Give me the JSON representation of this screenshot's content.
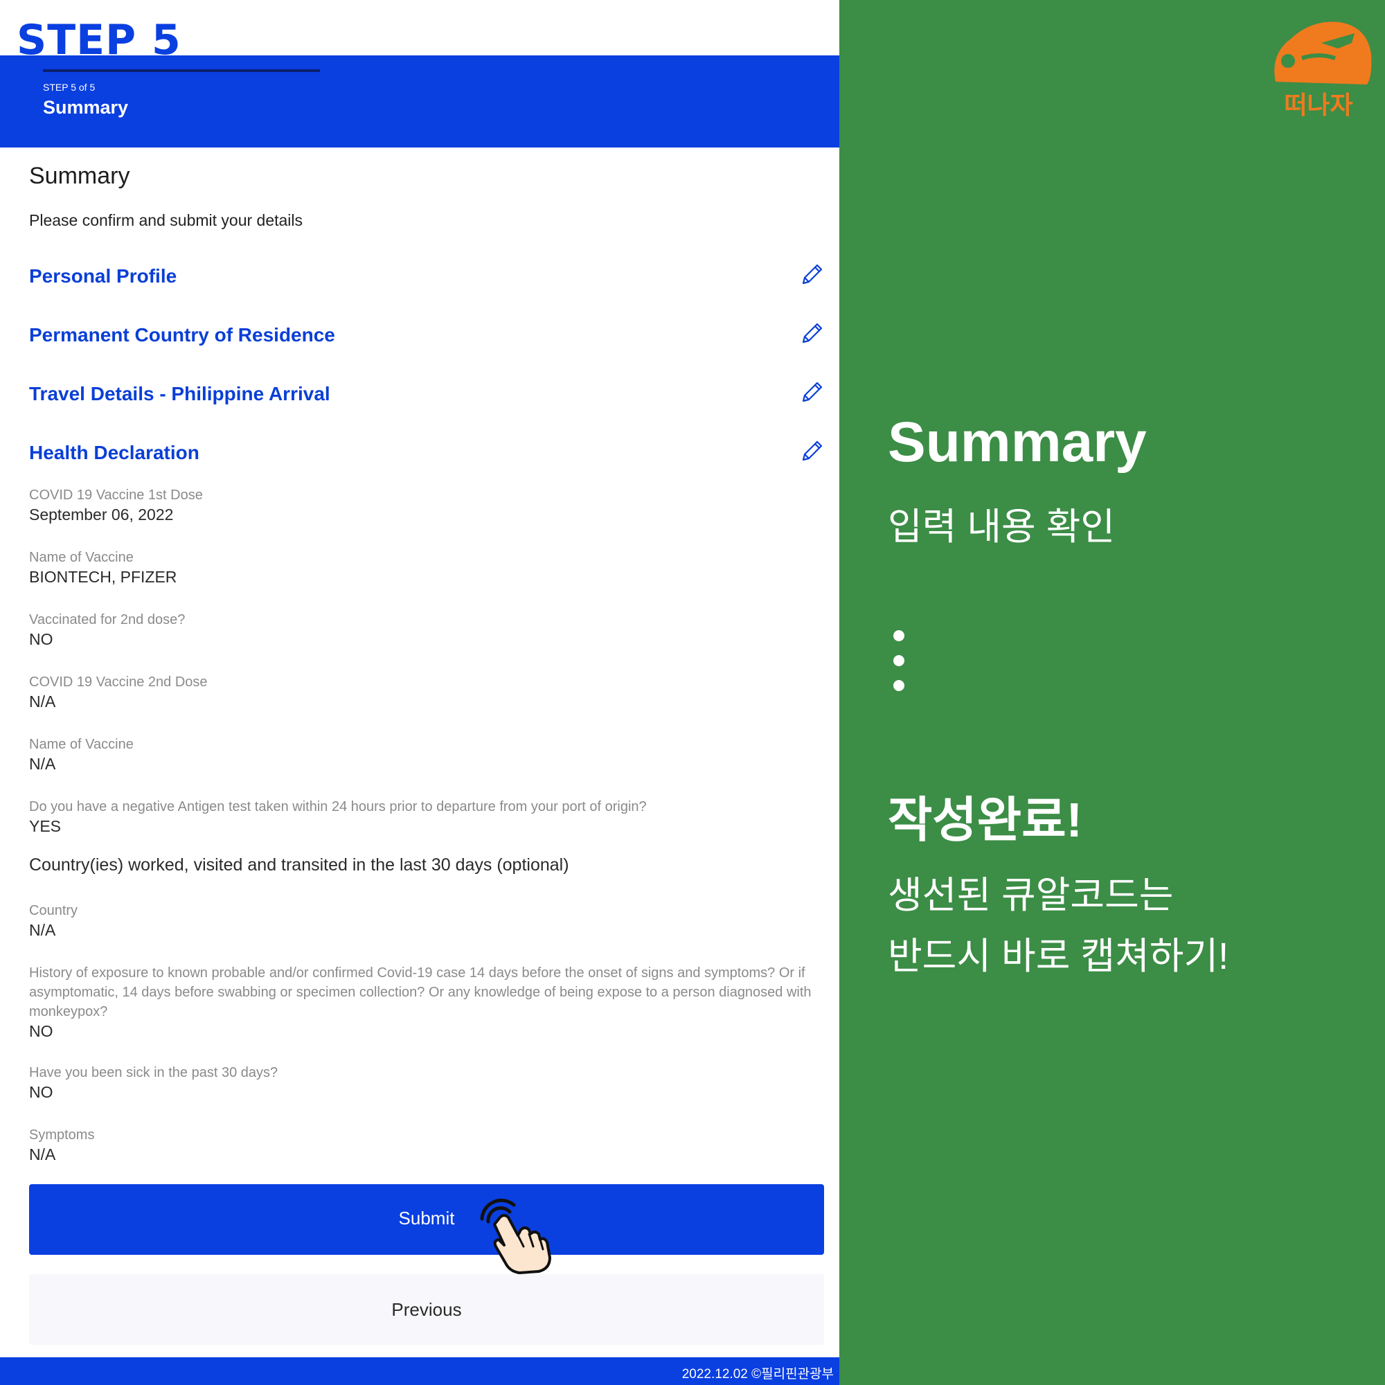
{
  "header": {
    "step_title": "STEP 5",
    "step_of": "STEP 5 of 5",
    "title": "Summary"
  },
  "summary": {
    "heading": "Summary",
    "subtitle": "Please confirm and submit your details"
  },
  "sections": [
    {
      "label": "Personal Profile",
      "icon": "pencil-icon"
    },
    {
      "label": "Permanent Country of Residence",
      "icon": "pencil-icon"
    },
    {
      "label": "Travel Details - Philippine Arrival",
      "icon": "pencil-icon"
    },
    {
      "label": "Health Declaration",
      "icon": "pencil-icon"
    }
  ],
  "fields": [
    {
      "question": "COVID 19 Vaccine 1st Dose",
      "answer": "September 06, 2022"
    },
    {
      "question": "Name of Vaccine",
      "answer": "BIONTECH, PFIZER"
    },
    {
      "question": "Vaccinated for 2nd dose?",
      "answer": "NO"
    },
    {
      "question": "COVID 19 Vaccine 2nd Dose",
      "answer": "N/A"
    },
    {
      "question": "Name of Vaccine",
      "answer": "N/A"
    },
    {
      "question": "Do you have a negative Antigen test taken within 24 hours prior to departure from your port of origin?",
      "answer": "YES"
    }
  ],
  "countries_heading": "Country(ies) worked, visited and transited in the last 30 days (optional)",
  "fields2": [
    {
      "question": "Country",
      "answer": "N/A"
    },
    {
      "question": "History of exposure to known probable and/or confirmed Covid-19 case 14 days before the onset of signs and symptoms? Or if asymptomatic, 14 days before swabbing or specimen collection? Or any knowledge of being expose to a person diagnosed with monkeypox?",
      "answer": "NO"
    },
    {
      "question": "Have you been sick in the past 30 days?",
      "answer": "NO"
    },
    {
      "question": "Symptoms",
      "answer": "N/A"
    }
  ],
  "buttons": {
    "submit": "Submit",
    "previous": "Previous"
  },
  "footer": {
    "credit": "2022.12.02 ©필리핀관광부"
  },
  "right_panel": {
    "logo_text": "떠나자",
    "title": "Summary",
    "subtitle": "입력 내용 확인",
    "done": "작성완료!",
    "line1": "생선된 큐알코드는",
    "line2": "반드시 바로 캡쳐하기!"
  },
  "colors": {
    "primary_blue": "#0a3fe0",
    "green": "#3c8d46",
    "logo_orange": "#f07a1e"
  }
}
